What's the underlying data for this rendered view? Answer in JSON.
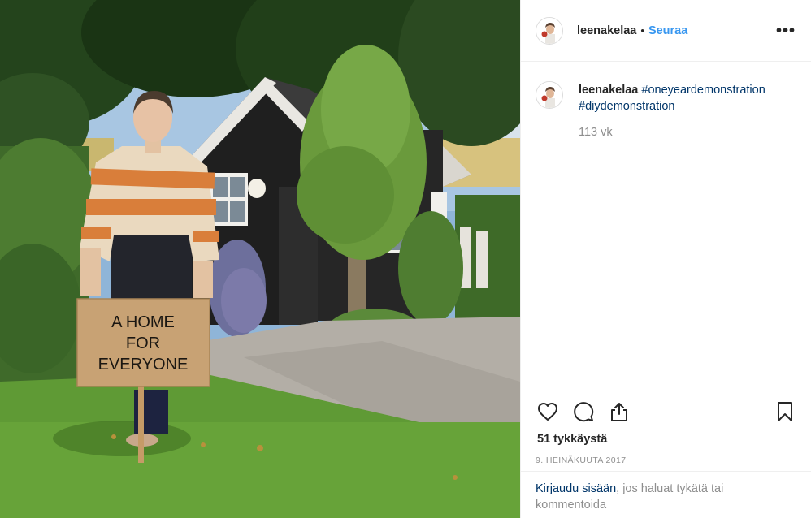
{
  "post": {
    "username": "leenakelaa",
    "dot": "•",
    "follow_label": "Seuraa",
    "more_label": "•••"
  },
  "caption": {
    "username": "leenakelaa",
    "hashtags": [
      "#oneyeardemonstration",
      "#diydemonstration"
    ],
    "time_ago": "113 vk"
  },
  "engagement": {
    "likes": "51 tykkäystä",
    "date": "9. HEINÄKUUTA 2017"
  },
  "login_prompt": {
    "link": "Kirjaudu sisään",
    "rest": ", jos haluat tykätä tai kommentoida"
  },
  "photo": {
    "sign_lines": [
      "A HOME",
      "FOR",
      "EVERYONE"
    ]
  },
  "colors": {
    "accent": "#3897f0",
    "link": "#003569",
    "muted": "#8e8e8e",
    "text": "#262626"
  },
  "icons": [
    "heart-icon",
    "comment-icon",
    "share-icon",
    "bookmark-icon",
    "more-icon"
  ]
}
